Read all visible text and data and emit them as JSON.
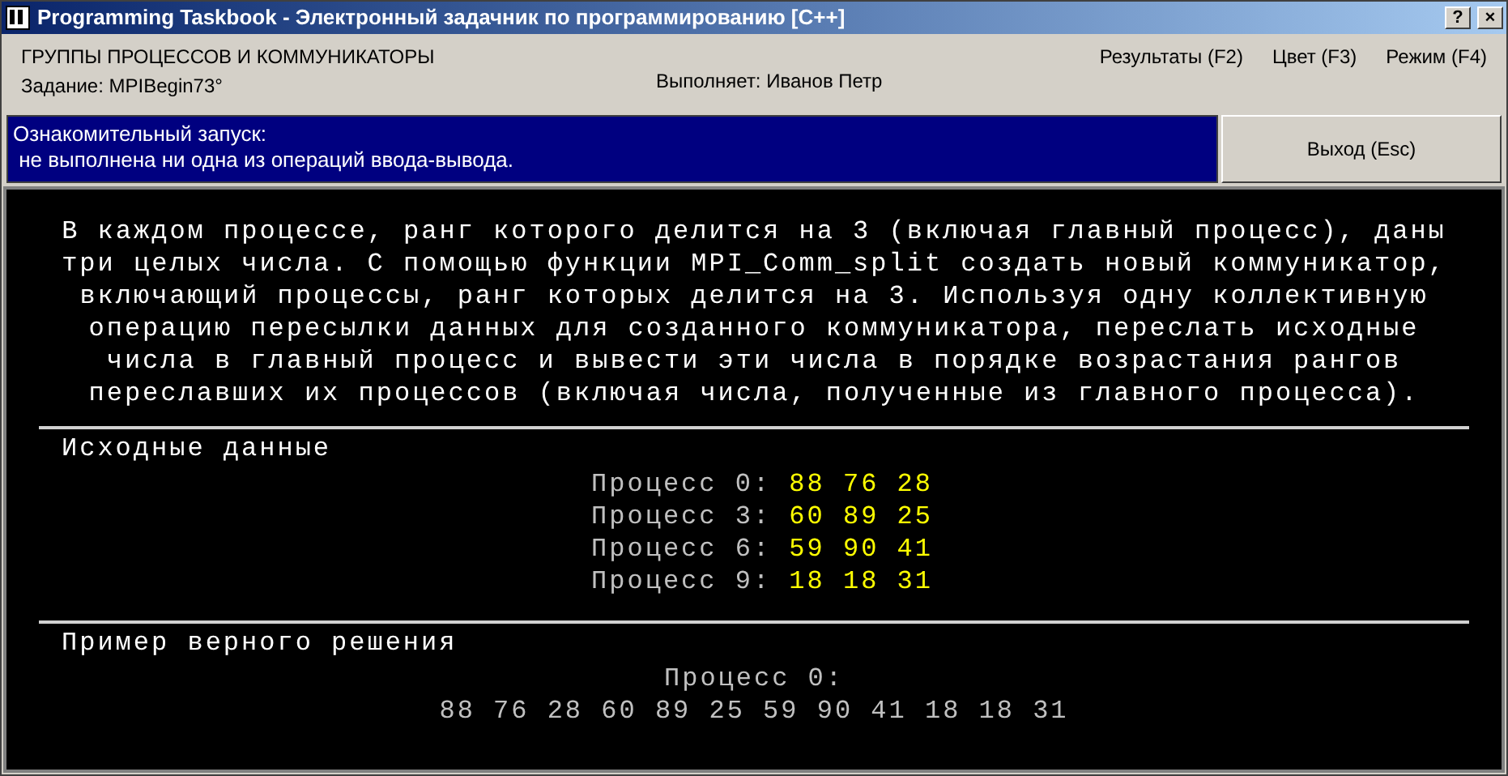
{
  "window": {
    "title": "Programming Taskbook - Электронный задачник по программированию [C++]",
    "buttons": [
      "?",
      "×"
    ]
  },
  "header": {
    "group": "ГРУППЫ ПРОЦЕССОВ И КОММУНИКАТОРЫ",
    "task": "Задание: MPIBegin73°",
    "performer": "Выполняет: Иванов Петр",
    "menu": [
      "Результаты (F2)",
      "Цвет (F3)",
      "Режим (F4)"
    ]
  },
  "status": {
    "lines": [
      "Ознакомительный запуск:",
      " не выполнена ни одна из операций ввода-вывода."
    ],
    "exit_button": "Выход (Esc)"
  },
  "description": [
    "В каждом процессе, ранг которого делится на 3 (включая главный процесс), даны",
    "три целых числа. С помощью функции MPI_Comm_split создать новый коммуникатор,",
    "включающий процессы, ранг которых делится на 3. Используя одну коллективную",
    "операцию пересылки данных для созданного коммуникатора, переслать исходные",
    "числа в главный процесс и вывести эти числа в порядке возрастания рангов",
    "переславших их процессов (включая числа, полученные из главного процесса)."
  ],
  "input_section": {
    "title": "Исходные данные",
    "rows": [
      {
        "label": "Процесс 0:",
        "values": "88 76 28"
      },
      {
        "label": "Процесс 3:",
        "values": "60 89 25"
      },
      {
        "label": "Процесс 6:",
        "values": "59 90 41"
      },
      {
        "label": "Процесс 9:",
        "values": "18 18 31"
      }
    ]
  },
  "example_section": {
    "title": "Пример верного решения",
    "rows": [
      {
        "label": "Процесс 0:"
      },
      {
        "label": "88 76 28 60 89 25 59 90 41 18 18 31"
      }
    ]
  }
}
